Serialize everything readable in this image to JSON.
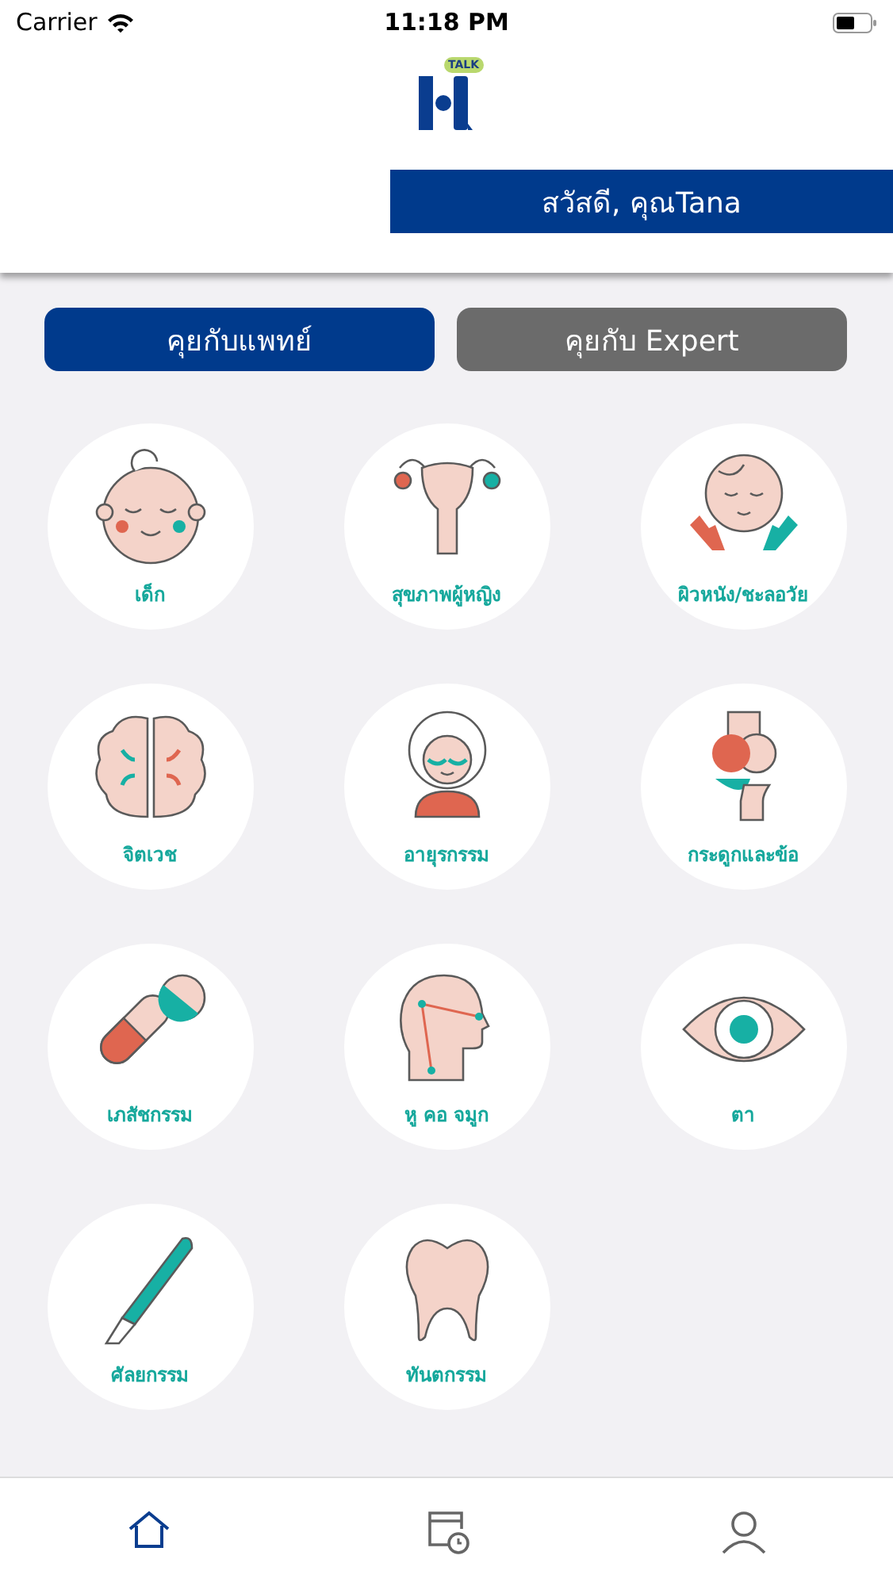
{
  "status_bar": {
    "carrier": "Carrier",
    "time": "11:18 PM"
  },
  "header": {
    "logo_badge": "TALK",
    "greeting": "สวัสดี, คุณTana"
  },
  "tabs": [
    {
      "label": "คุยกับแพทย์",
      "selected": true
    },
    {
      "label": "คุยกับ Expert",
      "selected": false
    }
  ],
  "categories": [
    {
      "label": "เด็ก",
      "kind": "baby"
    },
    {
      "label": "สุขภาพผู้หญิง",
      "kind": "uterus"
    },
    {
      "label": "ผิวหนัง/ชะลอวัย",
      "kind": "skin"
    },
    {
      "label": "จิตเวช",
      "kind": "brain"
    },
    {
      "label": "อายุรกรรม",
      "kind": "elderly"
    },
    {
      "label": "กระดูกและข้อ",
      "kind": "joint"
    },
    {
      "label": "เภสัชกรรม",
      "kind": "pills"
    },
    {
      "label": "หู คอ จมูก",
      "kind": "ent"
    },
    {
      "label": "ตา",
      "kind": "eye"
    },
    {
      "label": "ศัลยกรรม",
      "kind": "surgery"
    },
    {
      "label": "ทันตกรรม",
      "kind": "tooth"
    }
  ],
  "bottom_nav": [
    {
      "kind": "home",
      "selected": true
    },
    {
      "kind": "schedule",
      "selected": false
    },
    {
      "kind": "profile",
      "selected": false
    }
  ]
}
